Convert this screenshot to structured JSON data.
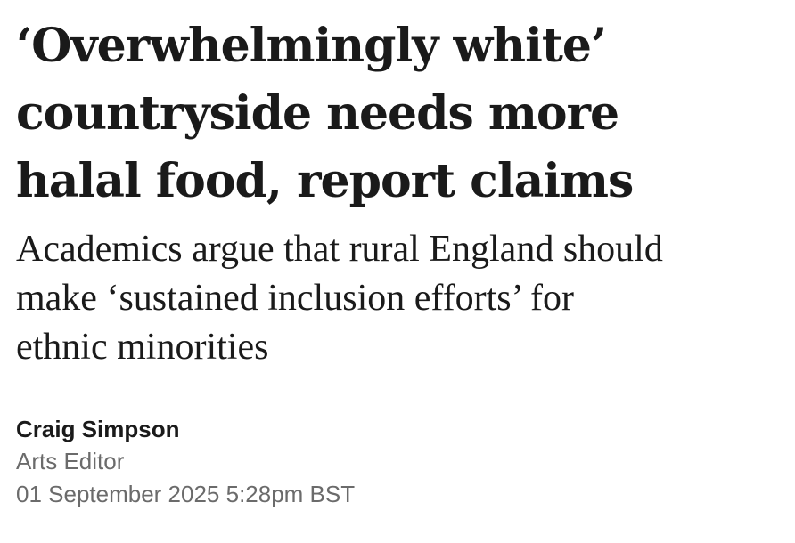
{
  "article": {
    "headline_lines": [
      "‘Overwhelmingly white’",
      "countryside needs more",
      "halal food, report claims"
    ],
    "standfirst_lines": [
      "Academics argue that rural England should",
      "make ‘sustained inclusion efforts’ for",
      "ethnic minorities"
    ],
    "author": {
      "name": "Craig Simpson",
      "role": "Arts Editor"
    },
    "timestamp": "01 September 2025 5:28pm BST"
  },
  "colors": {
    "text_primary": "#1a1a1a",
    "text_secondary": "#6b6b6b",
    "background": "#ffffff"
  }
}
